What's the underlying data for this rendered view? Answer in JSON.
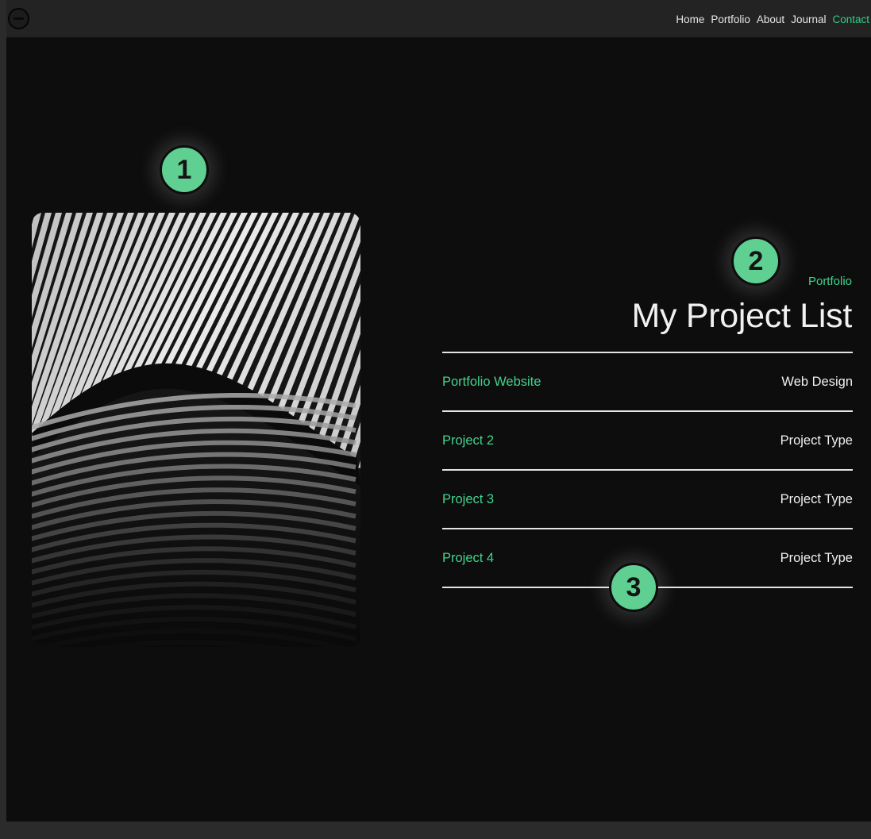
{
  "nav": {
    "items": [
      {
        "label": "Home",
        "active": false
      },
      {
        "label": "Portfolio",
        "active": false
      },
      {
        "label": "About",
        "active": false
      },
      {
        "label": "Journal",
        "active": false
      },
      {
        "label": "Contact",
        "active": true
      }
    ]
  },
  "hero_image": {
    "icon": "architecture-photo"
  },
  "section": {
    "eyebrow": "Portfolio",
    "title": "My Project List"
  },
  "projects": [
    {
      "name": "Portfolio Website",
      "type": "Web Design"
    },
    {
      "name": "Project 2",
      "type": "Project Type"
    },
    {
      "name": "Project 3",
      "type": "Project Type"
    },
    {
      "name": "Project 4",
      "type": "Project Type"
    }
  ],
  "badges": [
    "1",
    "2",
    "3"
  ],
  "colors": {
    "accent": "#3fd48f",
    "badge": "#5fcf92",
    "background": "#0d0d0d",
    "topbar": "#232323"
  }
}
